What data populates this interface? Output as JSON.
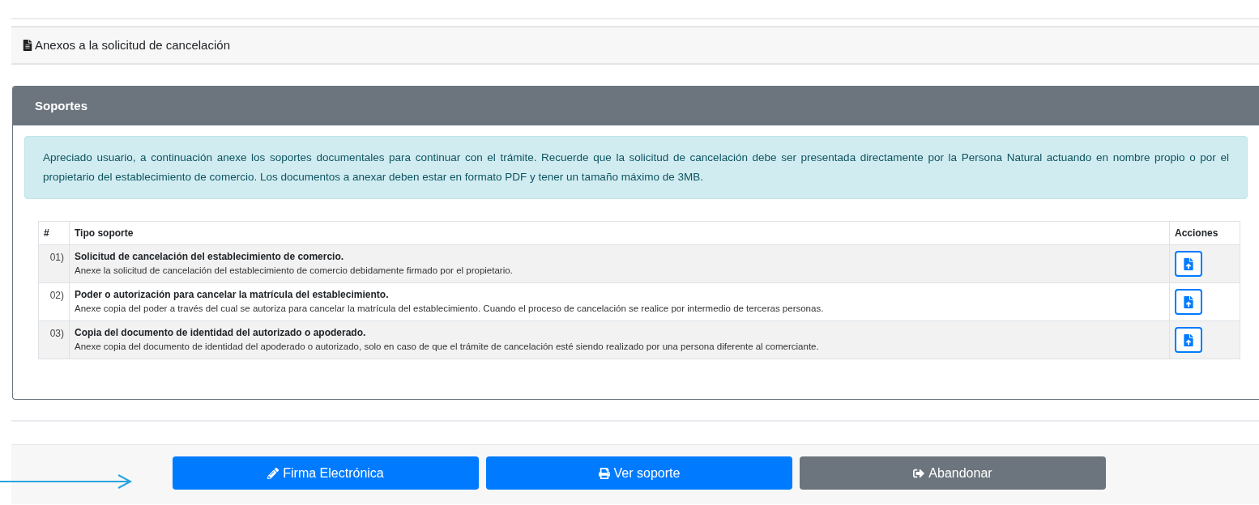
{
  "section": {
    "title": "Anexos a la solicitud de cancelación"
  },
  "card": {
    "title": "Soportes",
    "alert": "Apreciado usuario, a continuación anexe los soportes documentales para continuar con el trámite. Recuerde que la solicitud de cancelación debe ser presentada directamente por la Persona Natural actuando en nombre propio o por el propietario del establecimiento de comercio. Los documentos a anexar deben estar en formato PDF y tener un tamaño máximo de 3MB."
  },
  "table": {
    "columns": [
      "#",
      "Tipo soporte",
      "Acciones"
    ],
    "rows": [
      {
        "number": "01)",
        "title": "Solicitud de cancelación del establecimiento de comercio.",
        "description": "Anexe la solicitud de cancelación del establecimiento de comercio debidamente firmado por el propietario."
      },
      {
        "number": "02)",
        "title": "Poder o autorización para cancelar la matrícula del establecimiento.",
        "description": "Anexe copia del poder a través del cual se autoriza para cancelar la matrícula del establecimiento. Cuando el proceso de cancelación se realice por intermedio de terceras personas."
      },
      {
        "number": "03)",
        "title": "Copia del documento de identidad del autorizado o apoderado.",
        "description": "Anexe copia del documento de identidad del apoderado o autorizado, solo en caso de que el trámite de cancelación esté siendo realizado por una persona diferente al comerciante."
      }
    ]
  },
  "buttons": [
    {
      "kind": "sign",
      "label": "Firma Electrónica"
    },
    {
      "kind": "print",
      "label": "Ver soporte"
    },
    {
      "kind": "exit",
      "label": "Abandonar"
    }
  ]
}
